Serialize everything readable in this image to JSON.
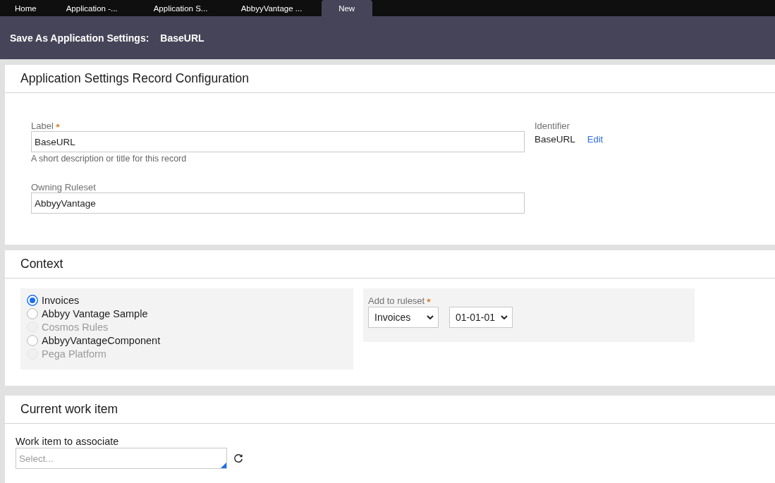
{
  "tabs": [
    {
      "label": "Home",
      "selected": false
    },
    {
      "label": "Application -...",
      "selected": false
    },
    {
      "label": "Application S...",
      "selected": false
    },
    {
      "label": "AbbyyVantage ...",
      "selected": false
    },
    {
      "label": "New",
      "selected": true
    }
  ],
  "header": {
    "title": "Save As Application Settings:",
    "record": "BaseURL"
  },
  "record_configuration": {
    "title": "Application Settings Record Configuration",
    "fields": [
      {
        "label": "Label",
        "required": true,
        "value": "BaseURL",
        "help": "A short description or title for this record"
      },
      {
        "label": "Owning Ruleset",
        "required": false,
        "value": "AbbyyVantage"
      }
    ],
    "identifier": {
      "label": "Identifier",
      "value": "BaseURL",
      "link": "Edit"
    }
  },
  "context": {
    "title": "Context",
    "options": [
      {
        "label": "Invoices",
        "selected": true,
        "disabled": false
      },
      {
        "label": "Abbyy Vantage Sample",
        "selected": false,
        "disabled": false
      },
      {
        "label": "Cosmos Rules",
        "selected": false,
        "disabled": true
      },
      {
        "label": "AbbyyVantageComponent",
        "selected": false,
        "disabled": false
      },
      {
        "label": "Pega Platform",
        "selected": false,
        "disabled": true
      }
    ],
    "add_to_ruleset": {
      "label": "Add to ruleset",
      "required": true,
      "ruleset": "Invoices",
      "version": "01-01-01"
    }
  },
  "current_work_item": {
    "title": "Current work item",
    "field": {
      "label": "Work item to associate",
      "placeholder": "Select..."
    }
  }
}
